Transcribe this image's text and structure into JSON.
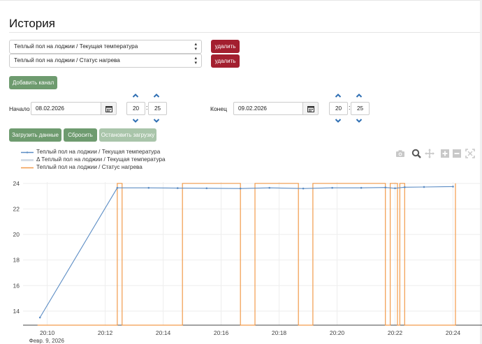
{
  "page": {
    "title": "История"
  },
  "channels": [
    {
      "name": "Теплый пол на лоджии / Текущая температура",
      "delete_label": "удалить"
    },
    {
      "name": "Теплый пол на лоджии / Статус нагрева",
      "delete_label": "удалить"
    }
  ],
  "add_channel_label": "Добавить канал",
  "range": {
    "start": {
      "label": "Начало",
      "date": "08.02.2026",
      "hour": "20",
      "minute": "25"
    },
    "end": {
      "label": "Конец",
      "date": "09.02.2026",
      "hour": "20",
      "minute": "25"
    }
  },
  "actions": {
    "load_label": "Загрузить данные",
    "reset_label": "Сбросить",
    "stop_label": "Остановить загрузку"
  },
  "modebar": [
    "camera-icon",
    "zoom-icon",
    "pan-icon",
    "zoom-in-icon",
    "zoom-out-icon",
    "autoscale-icon"
  ],
  "colors": {
    "accent_red": "#a31f2f",
    "accent_green": "#6e9b6f",
    "temperature_line": "#5b8cc4",
    "delta_band": "#d5dde6",
    "heating_line": "#f29b4b"
  },
  "chart_data": {
    "type": "line",
    "legend": [
      "Теплый пол на лоджии / Текущая температура",
      "Δ Теплый пол на лоджии / Текущая температура",
      "Теплый пол на лоджии / Статус нагрева"
    ],
    "legend_position": "top-left",
    "x_ticks": [
      "20:10",
      "20:12",
      "20:14",
      "20:16",
      "20:18",
      "20:20",
      "20:22",
      "20:24"
    ],
    "x_sub_label": "Февр. 9, 2026",
    "xlim": [
      "20:09:10",
      "20:25:00"
    ],
    "y_ticks": [
      14,
      16,
      18,
      20,
      22,
      24
    ],
    "ylim": [
      12.9,
      24.1
    ],
    "grid": true,
    "series": [
      {
        "name": "Теплый пол на лоджии / Текущая температура",
        "x": [
          "20:09:45",
          "20:12:25",
          "20:13:30",
          "20:14:30",
          "20:15:30",
          "20:16:40",
          "20:17:40",
          "20:18:50",
          "20:19:50",
          "20:20:50",
          "20:21:40",
          "20:22:00",
          "20:22:20",
          "20:23:00",
          "20:24:00"
        ],
        "y": [
          13.5,
          23.65,
          23.65,
          23.63,
          23.62,
          23.6,
          23.65,
          23.6,
          23.65,
          23.65,
          23.68,
          23.62,
          23.7,
          23.72,
          23.75
        ]
      },
      {
        "name": "Теплый пол на лоджии / Статус нагрева",
        "x": [
          "20:09:40",
          "20:12:25",
          "20:12:25",
          "20:12:35",
          "20:12:35",
          "20:14:40",
          "20:14:40",
          "20:16:40",
          "20:16:40",
          "20:17:10",
          "20:17:10",
          "20:18:40",
          "20:18:40",
          "20:19:10",
          "20:19:10",
          "20:21:40",
          "20:21:40",
          "20:21:50",
          "20:21:50",
          "20:22:05",
          "20:22:05",
          "20:22:10",
          "20:22:10",
          "20:22:20",
          "20:22:20",
          "20:24:05",
          "20:24:05"
        ],
        "y": [
          12.9,
          12.9,
          24,
          24,
          12.9,
          12.9,
          24,
          24,
          12.9,
          12.9,
          24,
          24,
          12.9,
          12.9,
          24,
          24,
          12.9,
          12.9,
          24,
          24,
          12.9,
          12.9,
          24,
          24,
          12.9,
          12.9,
          24
        ]
      }
    ]
  }
}
